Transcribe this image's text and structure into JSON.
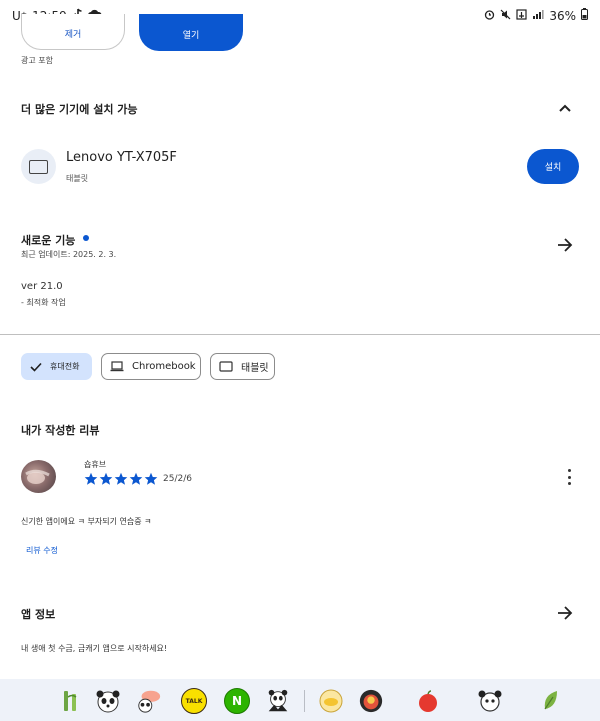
{
  "status_bar": {
    "carrier": "U⁺",
    "time": "12:59",
    "battery": "36%"
  },
  "top_actions": {
    "remove_label": "제거",
    "open_label": "열기",
    "ad_notice": "광고 포함"
  },
  "devices_section": {
    "title": "더 많은 기기에 설치 가능",
    "device_name": "Lenovo YT-X705F",
    "device_type": "태블릿",
    "install_label": "설치"
  },
  "whats_new": {
    "title": "새로운 기능",
    "updated": "최근 업데이트: 2025. 2. 3.",
    "version": "ver 21.0",
    "note": "- 최적화 작업"
  },
  "chips": [
    {
      "label": "휴대전화",
      "selected": true
    },
    {
      "label": "Chromebook",
      "selected": false
    },
    {
      "label": "태블릿",
      "selected": false
    }
  ],
  "my_review": {
    "title": "내가 작성한 리뷰",
    "reviewer": "숍휴브",
    "rating": 5,
    "date": "25/2/6",
    "body": "신기한 앱이에요 ㅋ 부자되기 연습중 ㅋ",
    "edit_label": "리뷰 수정"
  },
  "app_info": {
    "title": "앱 정보",
    "description": "내 생애 첫 수금, 금캐기 앱으로 시작하세요!"
  },
  "colors": {
    "accent": "#0b57d0",
    "chip_selected": "#d3e3fd",
    "emoji_bar": "#eef2f9"
  },
  "emoji_bar": {
    "items": [
      "bamboo-sticker",
      "panda-sticker",
      "panda-speech-sticker",
      "talk-sticker",
      "naver-sticker",
      "panda-cheer-sticker",
      "gold-sticker",
      "character-sticker",
      "apple-sticker",
      "panda-face-sticker",
      "leaf-sticker"
    ],
    "talk_text": "TALK",
    "naver_text": "N"
  }
}
